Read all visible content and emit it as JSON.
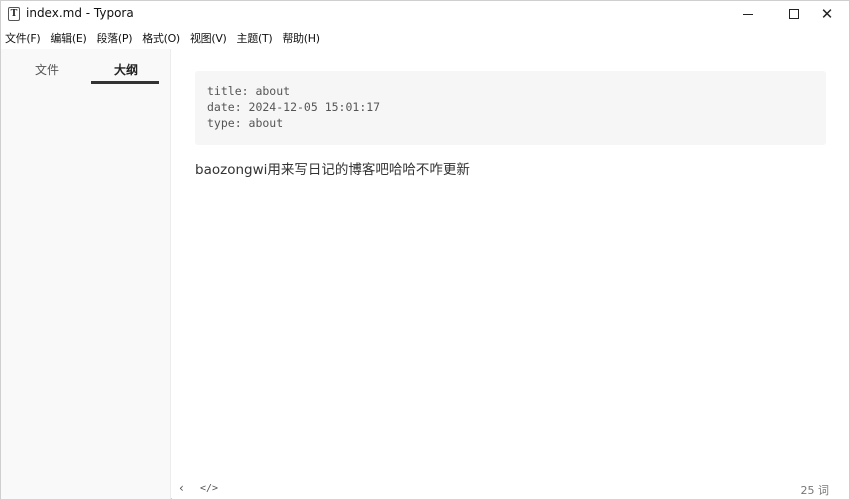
{
  "window": {
    "title": "index.md - Typora",
    "app_icon_letter": "T",
    "controls": {
      "minimize": "minimize-icon",
      "maximize": "maximize-icon",
      "close": "close-icon"
    }
  },
  "menubar": {
    "items": [
      "文件(F)",
      "编辑(E)",
      "段落(P)",
      "格式(O)",
      "视图(V)",
      "主题(T)",
      "帮助(H)"
    ]
  },
  "sidebar": {
    "tabs": [
      {
        "label": "文件",
        "active": false
      },
      {
        "label": "大纲",
        "active": true
      }
    ]
  },
  "editor": {
    "front_matter": [
      "title: about",
      "date: 2024-12-05 15:01:17",
      "type: about"
    ],
    "paragraph": "baozongwi用来写日记的博客吧哈哈不咋更新"
  },
  "footer": {
    "back_icon": "‹",
    "source_icon": "</>",
    "word_count": "25 词"
  },
  "colors": {
    "sidebar_bg": "#f9f9f9",
    "front_matter_bg": "#f6f6f6",
    "tab_underline": "#333333"
  }
}
